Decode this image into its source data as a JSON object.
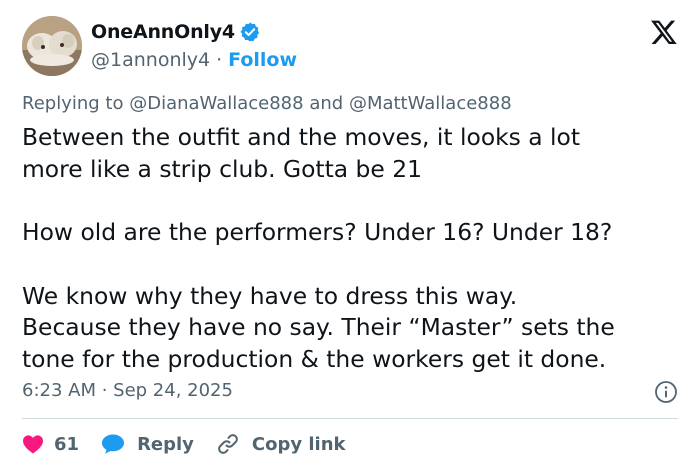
{
  "header": {
    "display_name": "OneAnnOnly4",
    "handle": "@1annonly4",
    "separator": "·",
    "follow_label": "Follow",
    "verified_icon": "verified-badge-icon",
    "logo_icon": "x-logo-icon"
  },
  "tweet": {
    "replying_prefix": "Replying to",
    "reply_mention_1": "@DianaWallace888",
    "reply_conjunction": "and",
    "reply_mention_2": "@MattWallace888",
    "text": "Between the outfit and the moves, it looks a lot\nmore like a strip club. Gotta be 21\n\nHow old are the performers? Under 16? Under 18?\n\nWe know why they have to dress this way.\nBecause they have no say. Their “Master” sets the\ntone for the production & the workers get it done.",
    "timestamp": "6:23 AM · Sep 24, 2025"
  },
  "actions": {
    "like_count": "61",
    "reply_label": "Reply",
    "copy_link_label": "Copy link"
  },
  "colors": {
    "accent": "#1d9bf0",
    "like": "#f91880",
    "muted": "#536471",
    "text": "#0f1419"
  }
}
